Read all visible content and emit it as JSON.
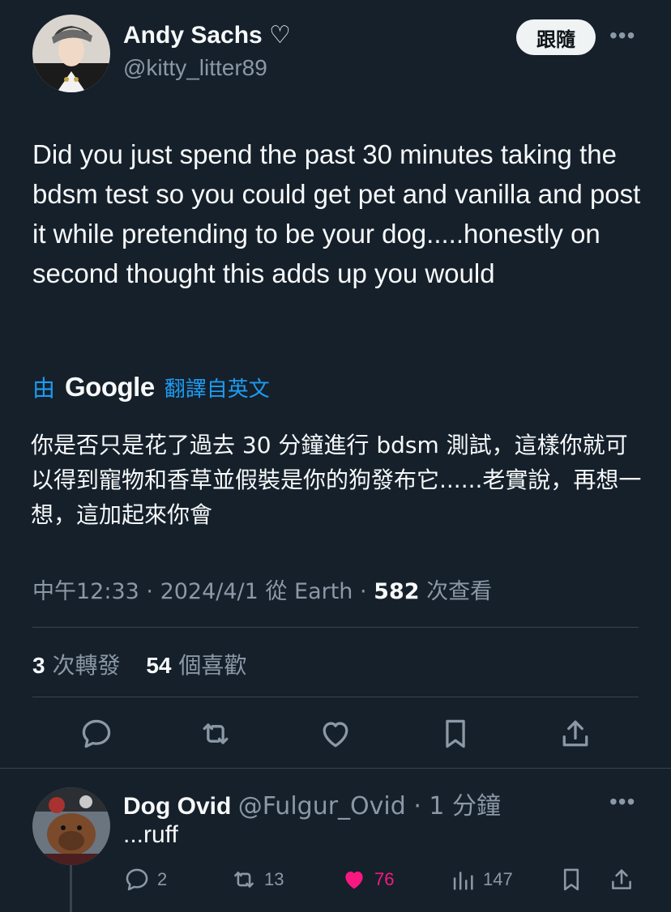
{
  "author": {
    "name": "Andy Sachs ♡",
    "handle": "@kitty_litter89",
    "follow_label": "跟隨"
  },
  "tweet": {
    "text": "Did you just spend the past 30 minutes taking the bdsm test so you could get pet and vanilla and post it while pretending to be your dog.....honestly on second thought this adds up you would",
    "translated_by_prefix": "由",
    "translator": "Google",
    "translated_from": "翻譯自英文",
    "translation": "你是否只是花了過去 30 分鐘進行 bdsm 測試，這樣你就可以得到寵物和香草並假裝是你的狗發布它......老實說，再想一想，這加起來你會",
    "time": "中午12:33",
    "date": "2024/4/1",
    "source": "從 Earth",
    "views_count": "582",
    "views_label": "次查看",
    "retweets_count": "3",
    "retweets_label": "次轉發",
    "likes_count": "54",
    "likes_label": "個喜歡"
  },
  "actions": {
    "reply_icon": "reply-icon",
    "retweet_icon": "retweet-icon",
    "like_icon": "heart-icon",
    "bookmark_icon": "bookmark-icon",
    "share_icon": "share-icon"
  },
  "reply": {
    "name": "Dog Ovid",
    "handle": "@Fulgur_Ovid",
    "time": "1 分鐘",
    "text": "...ruff",
    "replies": "2",
    "retweets": "13",
    "likes": "76",
    "views": "147"
  },
  "colors": {
    "background": "#15202b",
    "accent": "#1d9bf0",
    "like": "#f91880",
    "secondary_text": "#8b98a5"
  }
}
